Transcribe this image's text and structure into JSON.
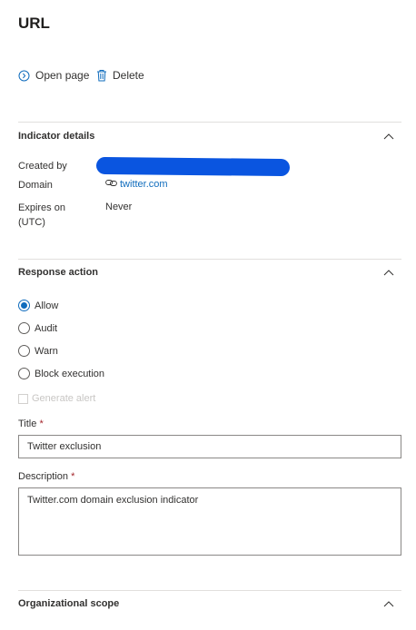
{
  "page": {
    "title": "URL"
  },
  "commands": {
    "open_label": "Open page",
    "delete_label": "Delete"
  },
  "indicator_details": {
    "header": "Indicator details",
    "created_by_label": "Created by",
    "domain_label": "Domain",
    "domain_value": "twitter.com",
    "expires_label_line1": "Expires on",
    "expires_label_line2": "(UTC)",
    "expires_value": "Never"
  },
  "response_action": {
    "header": "Response action",
    "options": [
      "Allow",
      "Audit",
      "Warn",
      "Block execution"
    ],
    "selected": "Allow",
    "generate_alert_label": "Generate alert"
  },
  "form": {
    "title_label": "Title",
    "title_value": "Twitter exclusion",
    "description_label": "Description",
    "description_value": "Twitter.com domain exclusion indicator",
    "required_marker": "*"
  },
  "org_scope": {
    "header": "Organizational scope"
  },
  "colors": {
    "accent": "#0f6cbd",
    "redaction": "#0a55e0",
    "required": "#a4262c"
  }
}
